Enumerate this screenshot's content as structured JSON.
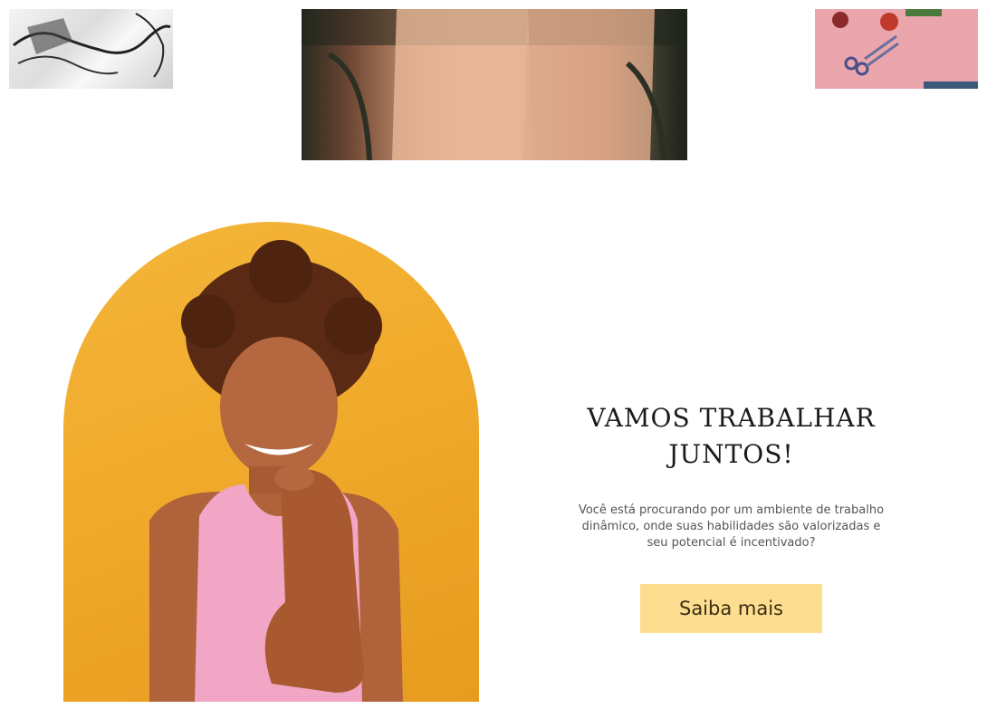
{
  "gallery": {
    "images": [
      {
        "name": "sketch-illustration-image"
      },
      {
        "name": "hands-closeup-image"
      },
      {
        "name": "manicure-tools-image"
      }
    ]
  },
  "hero": {
    "image_name": "smiling-woman-portrait",
    "background_color": "#f0a92a"
  },
  "cta": {
    "heading": "Vamos trabalhar juntos!",
    "body": "Você está procurando por um ambiente de trabalho dinâmico, onde suas habilidades são valorizadas e seu potencial é incentivado?",
    "button_label": "Saiba mais",
    "button_color": "#fddd8f"
  }
}
